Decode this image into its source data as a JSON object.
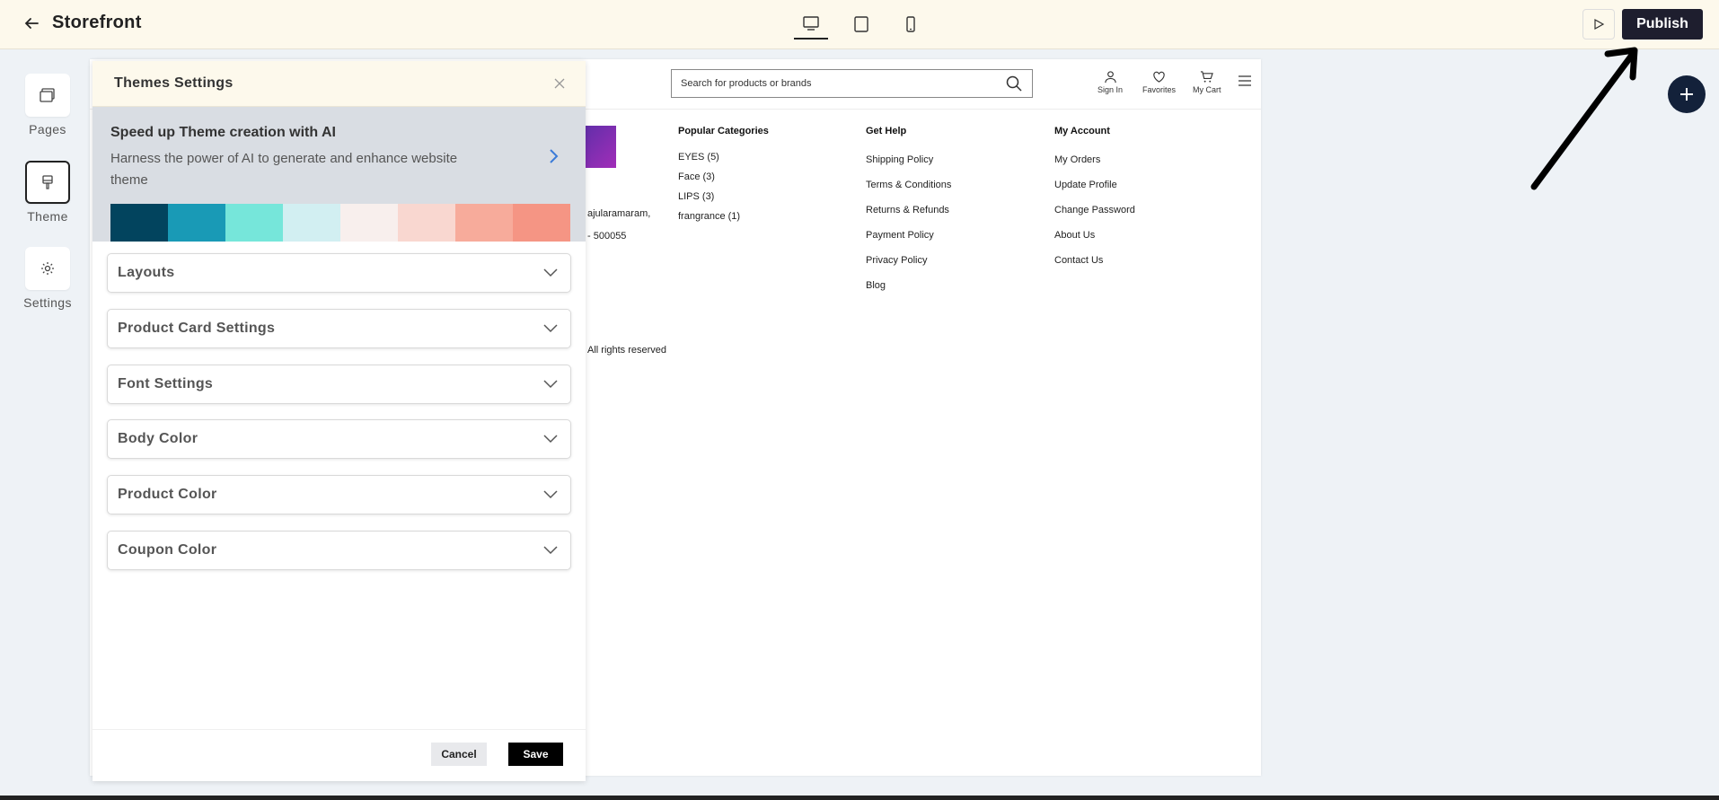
{
  "topbar": {
    "title": "Storefront",
    "devices": [
      "desktop-icon",
      "tablet-icon",
      "mobile-icon"
    ],
    "active_device": "desktop",
    "publish_label": "Publish"
  },
  "rail": {
    "items": [
      {
        "label": "Pages",
        "icon": "pages-icon"
      },
      {
        "label": "Theme",
        "icon": "brush-icon",
        "active": true
      },
      {
        "label": "Settings",
        "icon": "gear-icon"
      }
    ]
  },
  "site": {
    "search_placeholder": "Search for products or brands",
    "header_icons": [
      {
        "label": "Sign In",
        "icon": "user-icon"
      },
      {
        "label": "Favorites",
        "icon": "heart-icon"
      },
      {
        "label": "My Cart",
        "icon": "cart-icon"
      }
    ],
    "address_line1": "ajularamaram,",
    "address_line2": "- 500055",
    "rights": "All rights reserved",
    "columns": [
      {
        "title": "Popular Categories",
        "links": [
          "EYES (5)",
          "Face (3)",
          "LIPS (3)",
          "frangrance (1)"
        ]
      },
      {
        "title": "Get Help",
        "links": [
          "Shipping Policy",
          "Terms & Conditions",
          "Returns & Refunds",
          "Payment Policy",
          "Privacy Policy",
          "Blog"
        ]
      },
      {
        "title": "My Account",
        "links": [
          "My Orders",
          "Update Profile",
          "Change Password",
          "About Us",
          "Contact Us"
        ]
      }
    ]
  },
  "panel": {
    "title": "Themes Settings",
    "ai_title": "Speed up Theme creation with AI",
    "ai_desc": "Harness the power of AI to generate and enhance website theme",
    "palette": [
      "#02445e",
      "#199ab6",
      "#76e6da",
      "#d2eff2",
      "#f8efed",
      "#f9d7d0",
      "#f7ab9b",
      "#f59584"
    ],
    "sections": [
      "Layouts",
      "Product Card Settings",
      "Font Settings",
      "Body Color",
      "Product Color",
      "Coupon Color"
    ],
    "cancel_label": "Cancel",
    "save_label": "Save"
  },
  "colors": {
    "topbar_bg": "#fdf9ec",
    "publish_bg": "#1e1e2e",
    "fab_bg": "#13213a"
  }
}
